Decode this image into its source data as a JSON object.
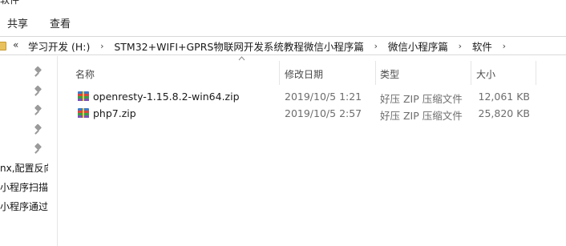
{
  "window": {
    "title_fragment": "软件"
  },
  "ribbon": {
    "tabs": [
      "共享",
      "查看"
    ]
  },
  "address_bar": {
    "overflow_label": "«",
    "separator": "›",
    "crumbs": [
      "学习开发 (H:)",
      "STM32+WIFI+GPRS物联网开发系统教程微信小程序篇",
      "微信小程序篇",
      "软件"
    ]
  },
  "nav_pane": {
    "items": [
      "nx,配置反向",
      "小程序扫描",
      "小程序通过"
    ]
  },
  "columns": {
    "name": "名称",
    "date": "修改日期",
    "type": "类型",
    "size": "大小",
    "sorted_by": "name"
  },
  "files": [
    {
      "icon": "zip-archive-icon",
      "name": "openresty-1.15.8.2-win64.zip",
      "modified": "2019/10/5 1:21",
      "type": "好压 ZIP 压缩文件",
      "size": "12,061 KB"
    },
    {
      "icon": "zip-archive-icon",
      "name": "php7.zip",
      "modified": "2019/10/5 2:57",
      "type": "好压 ZIP 压缩文件",
      "size": "25,820 KB"
    }
  ],
  "colors": {
    "folder": "#e8c15d",
    "divider": "#e5e5e5",
    "meta_text": "#6d6d6d"
  }
}
